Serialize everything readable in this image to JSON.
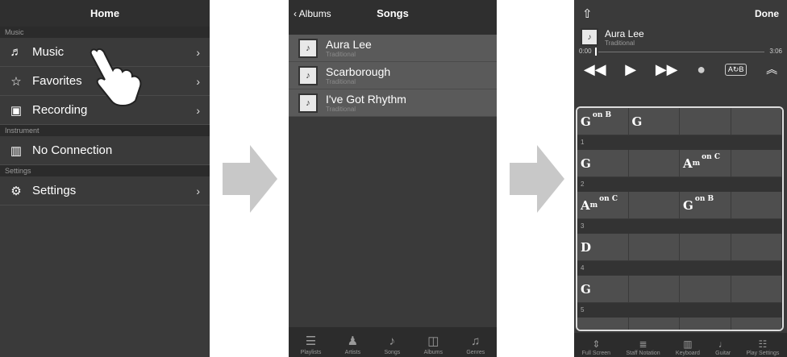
{
  "home": {
    "title": "Home",
    "sections": {
      "music": "Music",
      "instrument": "Instrument",
      "settings": "Settings"
    },
    "items": [
      {
        "label": "Music",
        "icon": "music-note-icon"
      },
      {
        "label": "Favorites",
        "icon": "star-icon"
      },
      {
        "label": "Recording",
        "icon": "recording-folder-icon"
      },
      {
        "label": "No Connection",
        "icon": "keyboard-icon"
      },
      {
        "label": "Settings",
        "icon": "gears-icon"
      }
    ]
  },
  "songs": {
    "back_label": "Albums",
    "title": "Songs",
    "list": [
      {
        "title": "Aura Lee",
        "artist": "Traditional"
      },
      {
        "title": "Scarborough",
        "artist": "Traditional"
      },
      {
        "title": "I've Got Rhythm",
        "artist": "Traditional"
      }
    ],
    "tabs": [
      "Playlists",
      "Artists",
      "Songs",
      "Albums",
      "Genres"
    ]
  },
  "player": {
    "done_label": "Done",
    "song_title": "Aura Lee",
    "song_artist": "Traditional",
    "time_current": "0:00",
    "time_total": "3:06",
    "ab_label": "A↻B",
    "bars": [
      {
        "num": "",
        "chords": [
          {
            "root": "G",
            "sup": "on B",
            "sub": ""
          },
          {
            "root": "G",
            "sup": "",
            "sub": ""
          },
          {
            "root": "",
            "sup": "",
            "sub": ""
          },
          {
            "root": "",
            "sup": "",
            "sub": ""
          }
        ]
      },
      {
        "num": "1",
        "chords": [
          {
            "root": "G",
            "sup": "",
            "sub": ""
          },
          {
            "root": "",
            "sup": "",
            "sub": ""
          },
          {
            "root": "A",
            "sup": "on C",
            "sub": "m"
          },
          {
            "root": "",
            "sup": "",
            "sub": ""
          }
        ]
      },
      {
        "num": "2",
        "chords": [
          {
            "root": "A",
            "sup": "on C",
            "sub": "m"
          },
          {
            "root": "",
            "sup": "",
            "sub": ""
          },
          {
            "root": "G",
            "sup": "on B",
            "sub": ""
          },
          {
            "root": "",
            "sup": "",
            "sub": ""
          }
        ]
      },
      {
        "num": "3",
        "chords": [
          {
            "root": "D",
            "sup": "",
            "sub": ""
          },
          {
            "root": "",
            "sup": "",
            "sub": ""
          },
          {
            "root": "",
            "sup": "",
            "sub": ""
          },
          {
            "root": "",
            "sup": "",
            "sub": ""
          }
        ]
      },
      {
        "num": "4",
        "chords": [
          {
            "root": "G",
            "sup": "",
            "sub": ""
          },
          {
            "root": "",
            "sup": "",
            "sub": ""
          },
          {
            "root": "",
            "sup": "",
            "sub": ""
          },
          {
            "root": "",
            "sup": "",
            "sub": ""
          }
        ]
      },
      {
        "num": "5",
        "chords": [
          {
            "root": "",
            "sup": "",
            "sub": ""
          },
          {
            "root": "",
            "sup": "",
            "sub": ""
          },
          {
            "root": "",
            "sup": "",
            "sub": ""
          },
          {
            "root": "",
            "sup": "",
            "sub": ""
          }
        ]
      }
    ],
    "tabs": [
      "Full Screen",
      "Staff Notation",
      "Keyboard",
      "Guitar",
      "Play Settings"
    ]
  }
}
